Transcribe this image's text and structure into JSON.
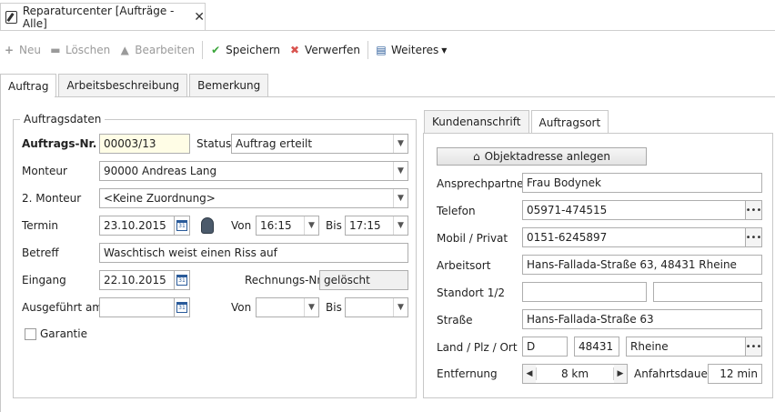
{
  "window": {
    "tab_title": "Reparaturcenter [Aufträge - Alle]",
    "close_glyph": "✕"
  },
  "toolbar": {
    "new_label": "Neu",
    "delete_label": "Löschen",
    "edit_label": "Bearbeiten",
    "save_label": "Speichern",
    "discard_label": "Verwerfen",
    "more_label": "Weiteres",
    "colors": {
      "save": "#3aa53a",
      "discard": "#d9534f",
      "disabled": "#9a9a9a"
    }
  },
  "tabs": [
    {
      "label": "Auftrag",
      "active": true
    },
    {
      "label": "Arbeitsbeschreibung",
      "active": false
    },
    {
      "label": "Bemerkung",
      "active": false
    }
  ],
  "order": {
    "group_title": "Auftragsdaten",
    "number_label": "Auftrags-Nr.",
    "number_value": "00003/13",
    "status_label": "Status",
    "status_value": "Auftrag erteilt",
    "monteur_label": "Monteur",
    "monteur_value": "90000 Andreas Lang",
    "monteur2_label": "2. Monteur",
    "monteur2_value": "<Keine Zuordnung>",
    "termin_label": "Termin",
    "termin_value": "23.10.2015",
    "von_label": "Von",
    "von_value": "16:15",
    "bis_label": "Bis",
    "bis_value": "17:15",
    "betreff_label": "Betreff",
    "betreff_value": "Waschtisch weist einen Riss auf",
    "eingang_label": "Eingang",
    "eingang_value": "22.10.2015",
    "rechnung_label": "Rechnungs-Nr",
    "rechnung_value": "gelöscht",
    "ausgefuehrt_label": "Ausgeführt am",
    "ausgefuehrt_value": "",
    "von2_label": "Von",
    "von2_value": "",
    "bis2_label": "Bis",
    "bis2_value": "",
    "garantie_label": "Garantie",
    "garantie_checked": false,
    "calendar_icon_text": "31"
  },
  "address_tabs": [
    {
      "label": "Kundenanschrift",
      "active": false
    },
    {
      "label": "Auftragsort",
      "active": true
    }
  ],
  "address": {
    "create_button_label": "Objektadresse anlegen",
    "contact_label": "Ansprechpartner",
    "contact_value": "Frau Bodynek",
    "phone_label": "Telefon",
    "phone_value": "05971-474515",
    "mobile_label": "Mobil / Privat",
    "mobile_value": "0151-6245897",
    "location_label": "Arbeitsort",
    "location_value": "Hans-Fallada-Straße 63, 48431 Rheine",
    "standort_label": "Standort 1/2",
    "standort1_value": "",
    "standort2_value": "",
    "street_label": "Straße",
    "street_value": "Hans-Fallada-Straße 63",
    "country_label": "Land / Plz / Ort",
    "country_value": "D",
    "zip_value": "48431",
    "city_value": "Rheine",
    "distance_label": "Entfernung",
    "distance_value": "8 km",
    "travel_label": "Anfahrtsdauer",
    "travel_value": "12 min",
    "dots_glyph": "•••"
  }
}
